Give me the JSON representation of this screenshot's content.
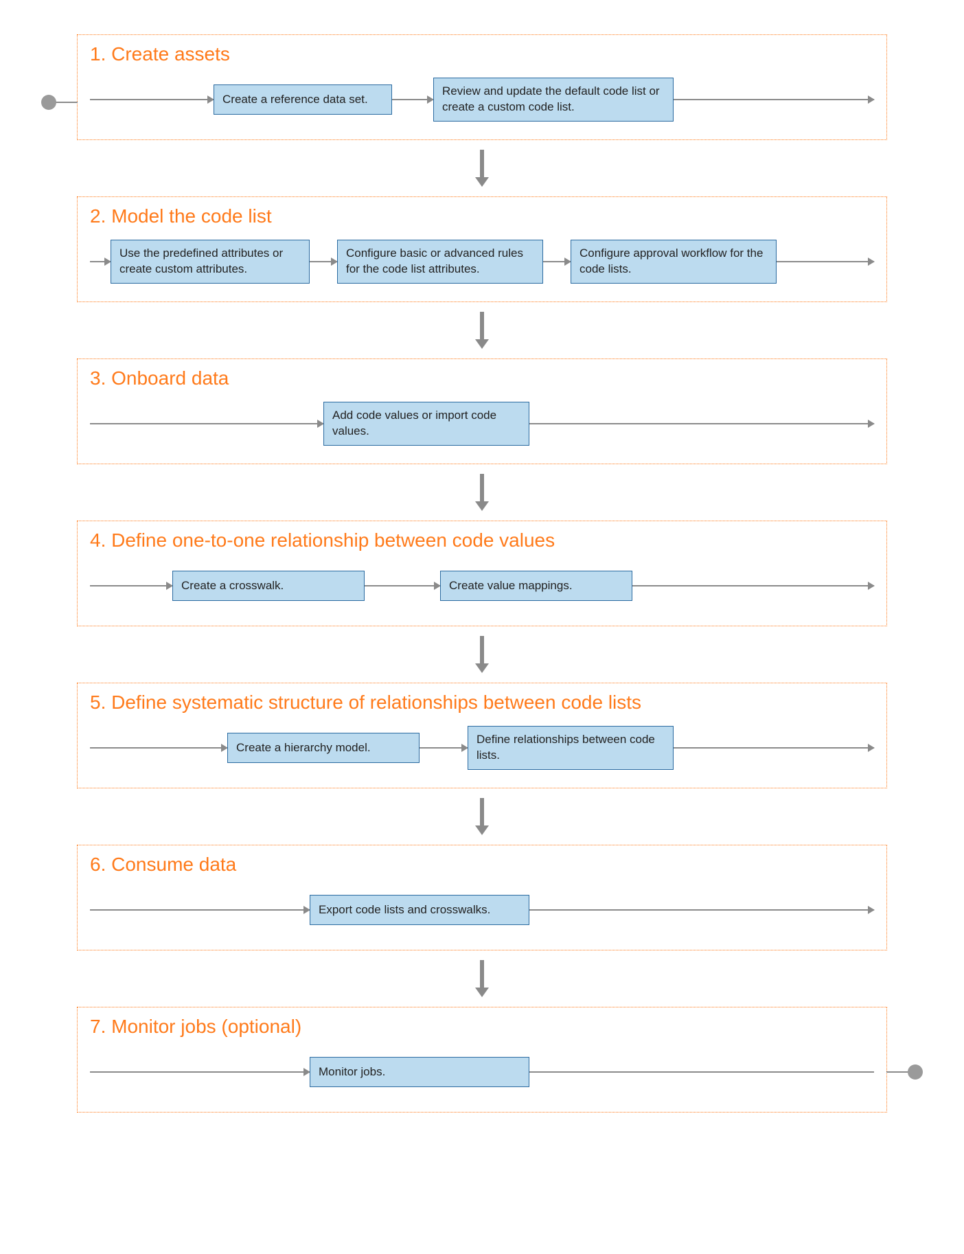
{
  "sections": [
    {
      "title": "1. Create assets",
      "nodes": [
        "Create a reference data set.",
        "Review and update the default code list or create a custom code list."
      ]
    },
    {
      "title": "2. Model the code list",
      "nodes": [
        "Use the predefined attributes or create custom attributes.",
        "Configure basic or advanced rules for the code list attributes.",
        "Configure approval workflow for the code lists."
      ]
    },
    {
      "title": "3. Onboard data",
      "nodes": [
        "Add code values or import code values."
      ]
    },
    {
      "title": "4. Define one-to-one relationship between code values",
      "nodes": [
        "Create a crosswalk.",
        "Create value mappings."
      ]
    },
    {
      "title": "5. Define systematic structure of relationships between code lists",
      "nodes": [
        "Create a hierarchy model.",
        "Define relationships between code lists."
      ]
    },
    {
      "title": "6. Consume data",
      "nodes": [
        "Export code lists and crosswalks."
      ]
    },
    {
      "title": "7. Monitor jobs (optional)",
      "nodes": [
        "Monitor jobs."
      ]
    }
  ]
}
